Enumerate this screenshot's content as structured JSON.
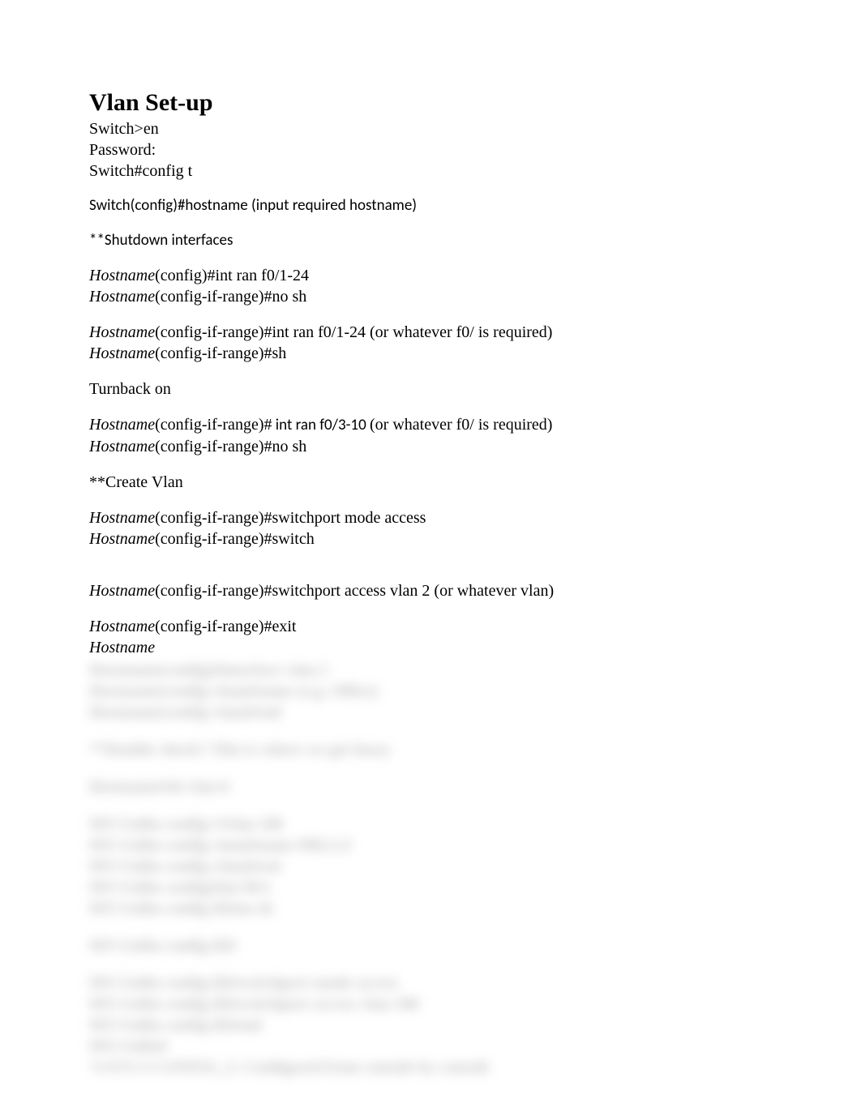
{
  "title": "Vlan Set-up",
  "lines": {
    "l1": "Switch>en",
    "l2": "Password:",
    "l3": "Switch#config t",
    "l4": "Switch(config)#hostname (input required hostname)",
    "l5": "**Shutdown interfaces",
    "l6_pre": "Hostname",
    "l6_post": "(config)#int ran f0/1-24",
    "l7_pre": "Hostname",
    "l7_post": "(config-if-range)#no sh",
    "l8_pre": "Hostname",
    "l8_post": "(config-if-range)#int ran f0/1-24 (or whatever f0/ is required)",
    "l9_pre": "Hostname",
    "l9_post": "(config-if-range)#sh",
    "l10": "Turnback on",
    "l11_pre": "Hostname",
    "l11_mid": "(config-if-range)#",
    "l11_sans": " int ran f0/3-10 ",
    "l11_end": "(or whatever f0/ is required)",
    "l12_pre": "Hostname",
    "l12_post": "(config-if-range)#no sh",
    "l13": "**Create Vlan",
    "l14_pre": "Hostname",
    "l14_post": "(config-if-range)#switchport mode access",
    "l15_pre": "Hostname",
    "l15_post": "(config-if-range)#switch",
    "l16_pre": "Hostname",
    "l16_post": "(config-if-range)#switchport access vlan 2 (or whatever vlan)",
    "l17_pre": "Hostname",
    "l17_post": "(config-if-range)#exit",
    "l18_pre": "Hostname"
  },
  "blurred": {
    "b1": "Hostname(config)#interface vlan 2",
    "b2": "Hostname(config-vlan)#name (e.g. Office)",
    "b3": "Hostname(config-vlan)#end",
    "b4": "**Double check? This is where we get fuzzy",
    "b5": "Hostname#sh vlan b",
    "b6": "MY-Unfin-config>#vlan 100",
    "b7": "MY-Unfin-config-vlan)#name PRLLZ",
    "b8": "MY-Unfin-config-vlan)#exit",
    "b9": "MY-Unfin-config)#int f0/2",
    "b10": "MY-Unfin-config-if)#no sh",
    "b11": "MY-Unfin-config-if)#",
    "b12": "MY-Unfin-config-if)#switchport mode access",
    "b13": "MY-Unfin-config-if)#switchport access vlan 100",
    "b14": "MY-Unfin-config-if)#end",
    "b15": "MY-Unfin#",
    "b16": "%SYS-5-CONFIG_I: Configured from console by console"
  }
}
